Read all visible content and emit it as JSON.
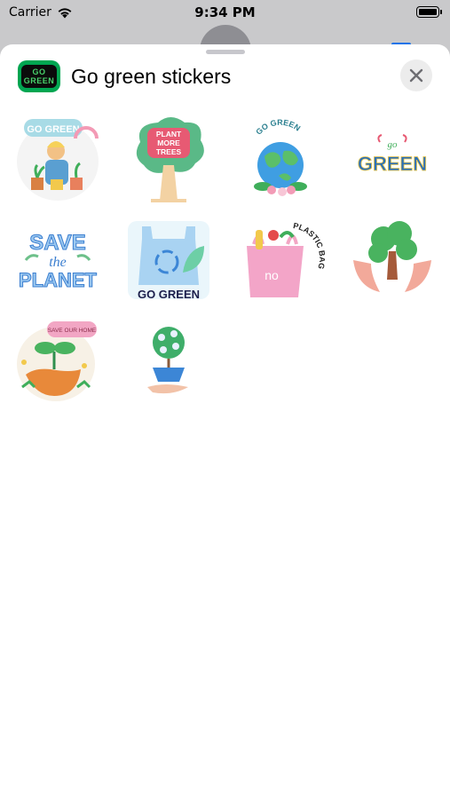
{
  "status": {
    "carrier": "Carrier",
    "time": "9:34 PM",
    "icons": [
      "wifi-icon",
      "battery-icon"
    ]
  },
  "header": {
    "title": "Go green stickers",
    "app_icon_text": [
      "GO",
      "GREEN"
    ],
    "close_icon": "close-icon"
  },
  "stickers": [
    {
      "name": "go-green-gardener",
      "text": "GO GREEN"
    },
    {
      "name": "plant-more-trees",
      "text": [
        "PLANT",
        "MORE",
        "TREES"
      ]
    },
    {
      "name": "go-green-earth",
      "text": "GO GREEN"
    },
    {
      "name": "go-green-lettering",
      "text": [
        "go",
        "GREEN"
      ]
    },
    {
      "name": "save-the-planet",
      "text": [
        "SAVE",
        "the",
        "PLANET"
      ]
    },
    {
      "name": "go-green-bag",
      "text": "GO GREEN"
    },
    {
      "name": "plastic-bag-no",
      "text": [
        "no",
        "PLASTIC BAG"
      ]
    },
    {
      "name": "tree-in-hands",
      "text": ""
    },
    {
      "name": "save-our-home",
      "text": "SAVE OUR HOME"
    },
    {
      "name": "tree-in-pot-hand",
      "text": ""
    }
  ],
  "colors": {
    "accent_green": "#00a651",
    "sheet": "#ffffff",
    "background": "#c9c9cb"
  }
}
